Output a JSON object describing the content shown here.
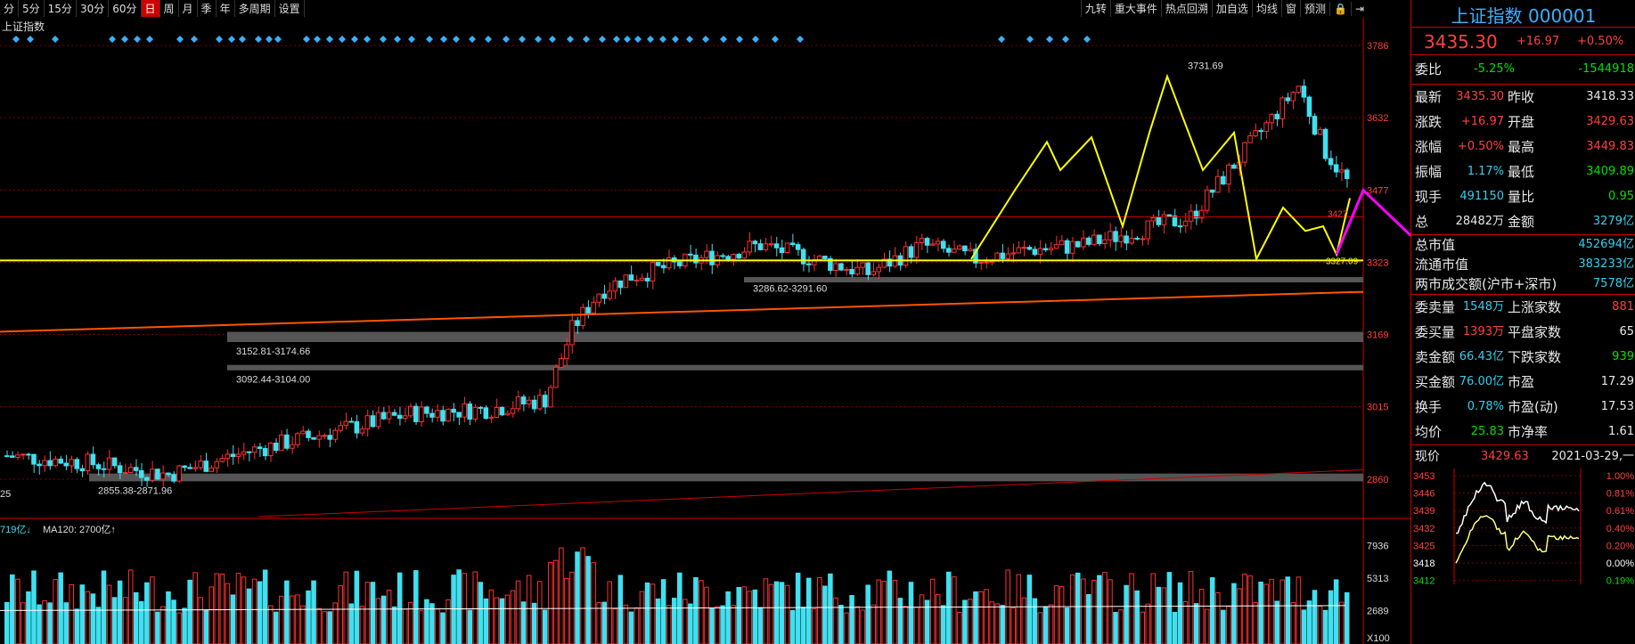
{
  "toolbar": {
    "left": [
      "分",
      "5分",
      "15分",
      "30分",
      "60分",
      "日",
      "周",
      "月",
      "季",
      "年",
      "多周期",
      "设置"
    ],
    "active_index": 5,
    "right": [
      "九转",
      "重大事件",
      "热点回溯",
      "加自选",
      "均线",
      "窗",
      "预测",
      "🔒",
      "⇥"
    ]
  },
  "chart_title": "上证指数",
  "y_ticks": [
    "3786",
    "3632",
    "3477",
    "3323",
    "3169",
    "3015",
    "2860"
  ],
  "y_tick_values": [
    3786,
    3632,
    3477,
    3323,
    3169,
    3015,
    2860
  ],
  "price_labels": {
    "high": "3731.69",
    "low_recent": "3327.09",
    "recent_hi": "3427",
    "gap1": "3152.81-3174.66",
    "gap2": "3092.44-3104.00",
    "gap3": "2855.38-2871.96",
    "gap4": "3286.62-3291.60",
    "left_partial": "25"
  },
  "volume": {
    "label_left": "719亿",
    "ma_label": "MA120: 2700亿",
    "ticks": [
      "7936",
      "5313",
      "2689",
      "X100"
    ],
    "tick_values": [
      7936,
      5313,
      2689,
      0
    ]
  },
  "chart_data": {
    "type": "candlestick",
    "price_axis_range": [
      2780,
      3830
    ],
    "volume_axis_range": [
      0,
      9200
    ],
    "support_line_y": 3327,
    "resistance_line_y": 3420,
    "gaps": [
      {
        "label": "3152.81-3174.66",
        "low": 3152.81,
        "high": 3174.66
      },
      {
        "label": "3092.44-3104.00",
        "low": 3092.44,
        "high": 3104.0
      },
      {
        "label": "2855.38-2871.96",
        "low": 2855.38,
        "high": 2871.96
      },
      {
        "label": "3286.62-3291.60",
        "low": 3286.62,
        "high": 3291.6
      }
    ]
  },
  "panel": {
    "title": "上证指数 000001",
    "price": "3435.30",
    "change": "+16.97",
    "change_pct": "+0.50%",
    "wb_label": "委比",
    "wb_pct": "-5.25%",
    "wb_val": "-1544918",
    "rows": [
      {
        "l1": "最新",
        "v1": "3435.30",
        "c1": "red",
        "l2": "昨收",
        "v2": "3418.33",
        "c2": "white"
      },
      {
        "l1": "涨跌",
        "v1": "+16.97",
        "c1": "red",
        "l2": "开盘",
        "v2": "3429.63",
        "c2": "red"
      },
      {
        "l1": "涨幅",
        "v1": "+0.50%",
        "c1": "red",
        "l2": "最高",
        "v2": "3449.83",
        "c2": "red"
      },
      {
        "l1": "振幅",
        "v1": "1.17%",
        "c1": "cyan",
        "l2": "最低",
        "v2": "3409.89",
        "c2": "green"
      },
      {
        "l1": "现手",
        "v1": "491150",
        "c1": "cyan",
        "l2": "量比",
        "v2": "0.95",
        "c2": "green"
      },
      {
        "l1": "总",
        "v1": "28482万",
        "c1": "white",
        "l2": "金额",
        "v2": "3279亿",
        "c2": "cyan"
      }
    ],
    "mcap_rows": [
      {
        "l": "总市值",
        "v": "452694亿"
      },
      {
        "l": "流通市值",
        "v": "383233亿"
      },
      {
        "l": "两市成交额(沪市+深市)",
        "v": "7578亿"
      }
    ],
    "rows2": [
      {
        "l1": "委卖量",
        "v1": "1548万",
        "c1": "cyan",
        "l2": "上涨家数",
        "v2": "881",
        "c2": "red"
      },
      {
        "l1": "委买量",
        "v1": "1393万",
        "c1": "red",
        "l2": "平盘家数",
        "v2": "65",
        "c2": "white"
      },
      {
        "l1": "卖金额",
        "v1": "66.43亿",
        "c1": "cyan",
        "l2": "下跌家数",
        "v2": "939",
        "c2": "green"
      },
      {
        "l1": "买金额",
        "v1": "76.00亿",
        "c1": "cyan",
        "l2": "市盈",
        "v2": "17.29",
        "c2": "white"
      },
      {
        "l1": "换手",
        "v1": "0.78%",
        "c1": "cyan",
        "l2": "市盈(动)",
        "v2": "17.53",
        "c2": "white"
      },
      {
        "l1": "均价",
        "v1": "25.83",
        "c1": "green",
        "l2": "市净率",
        "v2": "1.61",
        "c2": "white"
      }
    ],
    "now_label": "现价",
    "now_val": "3429.63",
    "date": "2021-03-29,一",
    "mini_left": [
      "3453",
      "3446",
      "3439",
      "3432",
      "3425",
      "3418",
      "3412"
    ],
    "mini_right": [
      "1.00%",
      "0.81%",
      "0.61%",
      "0.40%",
      "0.20%",
      "0.00%",
      "0.19%"
    ]
  }
}
